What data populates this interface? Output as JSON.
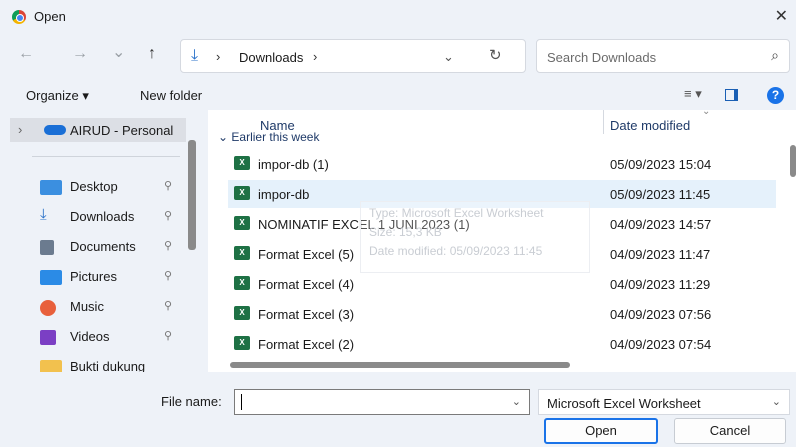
{
  "window": {
    "title": "Open",
    "close_glyph": "✕"
  },
  "nav": {
    "back": "←",
    "forward": "→",
    "recent": "⌄",
    "up": "↑",
    "address": {
      "location": "Downloads",
      "sep": "›",
      "dropdown": "⌄",
      "refresh": "↻"
    },
    "search_placeholder": "Search Downloads",
    "search_icon": "⌕"
  },
  "toolbar": {
    "organize": "Organize ▾",
    "new_folder": "New folder",
    "view": "≡ ▾",
    "help": "?"
  },
  "sidebar": {
    "selected": {
      "chevron": "›",
      "label": "AIRUD - Personal"
    },
    "items": [
      {
        "label": "Desktop",
        "icon": "desktop-icon",
        "color": "#3b8fe0"
      },
      {
        "label": "Downloads",
        "icon": "download-icon",
        "color": "#2a71c9"
      },
      {
        "label": "Documents",
        "icon": "documents-icon",
        "color": "#6b7b8f"
      },
      {
        "label": "Pictures",
        "icon": "pictures-icon",
        "color": "#2b8be6"
      },
      {
        "label": "Music",
        "icon": "music-icon",
        "color": "#e8603c"
      },
      {
        "label": "Videos",
        "icon": "videos-icon",
        "color": "#7b3fc4"
      },
      {
        "label": "Bukti dukung",
        "icon": "folder-icon",
        "color": "#f2c14e"
      }
    ],
    "pin": "📌"
  },
  "files": {
    "headers": {
      "name": "Name",
      "date": "Date modified"
    },
    "group": "Earlier this week",
    "rows": [
      {
        "name": "impor-db (1)",
        "date": "05/09/2023 15:04"
      },
      {
        "name": "impor-db",
        "date": "05/09/2023 11:45"
      },
      {
        "name": "NOMINATIF EXCEL 1 JUNI 2023 (1)",
        "date": "04/09/2023 14:57"
      },
      {
        "name": "Format Excel (5)",
        "date": "04/09/2023 11:47"
      },
      {
        "name": "Format Excel (4)",
        "date": "04/09/2023 11:29"
      },
      {
        "name": "Format Excel (3)",
        "date": "04/09/2023 07:56"
      },
      {
        "name": "Format Excel (2)",
        "date": "04/09/2023 07:54"
      }
    ],
    "selected_index": 1,
    "tooltip": {
      "type": "Type: Microsoft Excel Worksheet",
      "size": "Size: 15,3 KB",
      "modified": "Date modified: 05/09/2023 11:45"
    }
  },
  "bottom": {
    "file_name_label": "File name:",
    "file_name_value": "",
    "file_type": "Microsoft Excel Worksheet",
    "open": "Open",
    "cancel": "Cancel"
  }
}
